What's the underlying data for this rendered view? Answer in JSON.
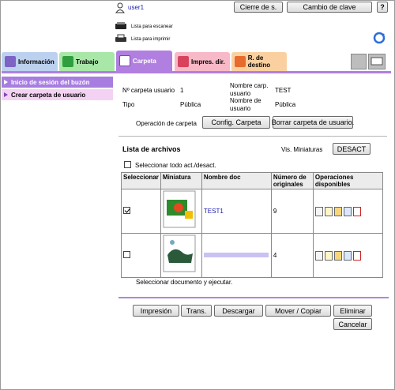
{
  "user": {
    "name": "user1"
  },
  "header": {
    "logout_label": "Cierre de s.",
    "change_password_label": "Cambio de clave",
    "help_label": "?",
    "scan_status": "Lista para escanear",
    "print_status": "Lista para imprimir"
  },
  "tabs": [
    {
      "label": "Información",
      "color": "#bcd0ef"
    },
    {
      "label": "Trabajo",
      "color": "#a8e7a8"
    },
    {
      "label": "Carpeta",
      "color": "#b07fe0"
    },
    {
      "label": "Impres. dir.",
      "color": "#f7b9c8"
    },
    {
      "label": "R. de destino",
      "color": "#fbd0a0"
    }
  ],
  "sidebar": {
    "items": [
      {
        "label": "Inicio de sesión del buzón"
      },
      {
        "label": "Crear carpeta de usuario"
      }
    ]
  },
  "folder_info": {
    "number_label": "Nº carpeta usuario",
    "number_value": "1",
    "name_label_line1": "Nombre carp.",
    "name_label_line2": "usuario",
    "name_value": "TEST",
    "type_label": "Tipo",
    "type_value": "Pública",
    "user_name_label_line1": "Nombre de",
    "user_name_label_line2": "usuario",
    "user_name_value": "Pública",
    "operation_label": "Operación de carpeta",
    "config_button": "Config. Carpeta",
    "delete_button": "Borrar carpeta de usuario."
  },
  "file_list": {
    "title": "Lista de archivos",
    "thumb_view_label": "Vis. Miniaturas",
    "thumb_view_button": "DESACT",
    "select_all_label": "Seleccionar todo act./desact.",
    "columns": [
      "Seleccionar",
      "Miniatura",
      "Nombre doc",
      "Número de originales",
      "Operaciones disponibles"
    ],
    "rows": [
      {
        "checked": true,
        "name": "TEST1",
        "originals": "9"
      },
      {
        "checked": false,
        "name": "",
        "originals": "4"
      }
    ],
    "instruction": "Seleccionar documento y ejecutar."
  },
  "actions": {
    "print": "Impresión",
    "send": "Trans.",
    "download": "Descargar",
    "move_copy": "Mover / Copiar",
    "delete": "Eliminar",
    "cancel": "Cancelar"
  }
}
